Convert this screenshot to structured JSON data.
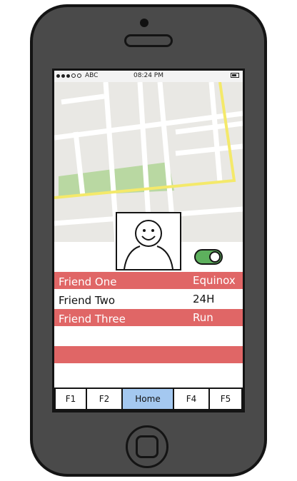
{
  "status_bar": {
    "carrier": "ABC",
    "time": "08:24 PM",
    "signal_bars": 3,
    "signal_total": 5
  },
  "map": {
    "colors": {
      "land": "#e9e8e4",
      "road": "#ffffff",
      "highlight_road": "#f4e96a",
      "park": "#b9d8a2"
    }
  },
  "profile": {
    "avatar_icon": "smiley-face-icon"
  },
  "toggle": {
    "state": "on",
    "color": "#5db05d"
  },
  "friends": [
    {
      "name": "Friend One",
      "value": "Equinox",
      "style": "red"
    },
    {
      "name": "Friend Two",
      "value": "24H",
      "style": "white"
    },
    {
      "name": "Friend Three",
      "value": "Run",
      "style": "red"
    },
    {
      "name": "",
      "value": "",
      "style": "white"
    },
    {
      "name": "",
      "value": "",
      "style": "red"
    },
    {
      "name": "",
      "value": "",
      "style": "white"
    }
  ],
  "tabs": [
    {
      "label": "F1",
      "active": false
    },
    {
      "label": "F2",
      "active": false
    },
    {
      "label": "Home",
      "active": true
    },
    {
      "label": "F4",
      "active": false
    },
    {
      "label": "F5",
      "active": false
    }
  ],
  "colors": {
    "accent_red": "#e06666",
    "tab_active": "#a4c8f0",
    "phone_body": "#4a4a4a"
  }
}
